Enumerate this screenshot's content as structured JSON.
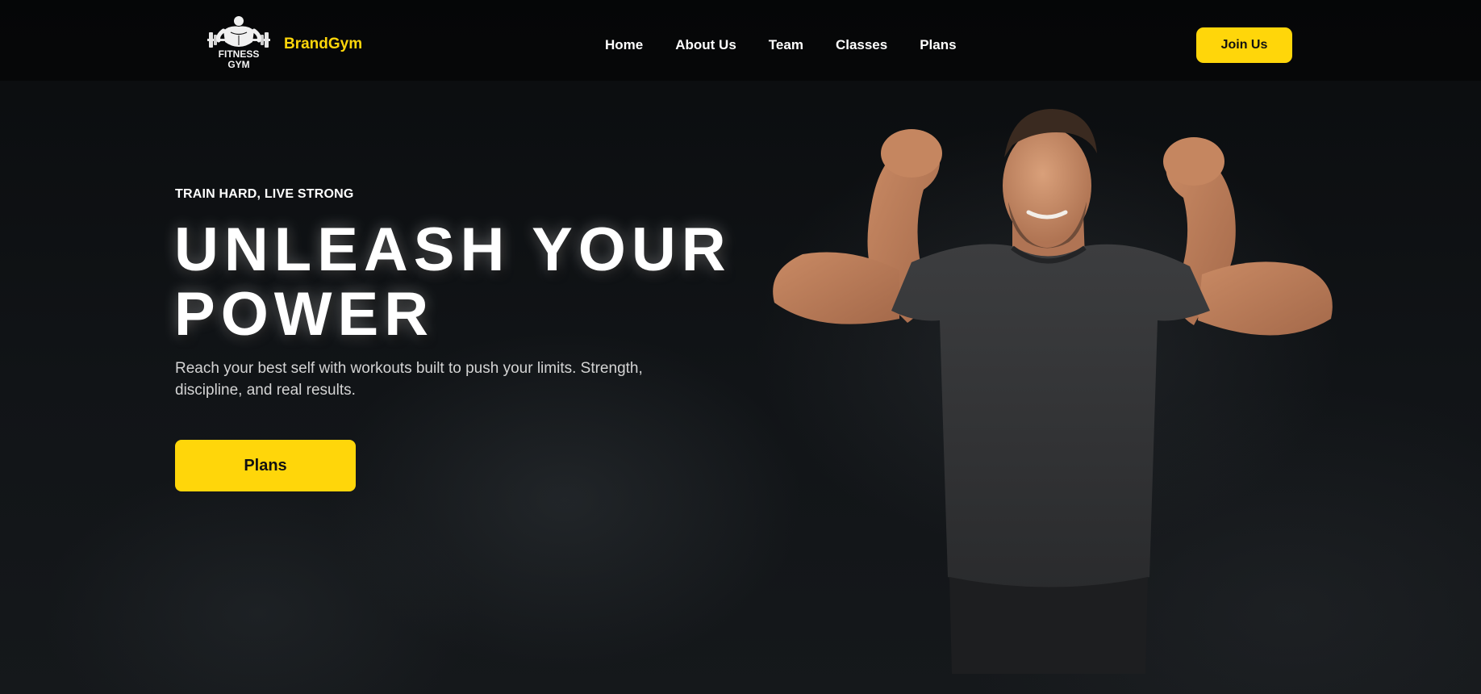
{
  "header": {
    "logo": {
      "icon": "bodybuilder-barbell-logo-icon",
      "line1": "FITNESS",
      "line2": "GYM"
    },
    "brand": "BrandGym",
    "nav": [
      {
        "label": "Home"
      },
      {
        "label": "About Us"
      },
      {
        "label": "Team"
      },
      {
        "label": "Classes"
      },
      {
        "label": "Plans"
      }
    ],
    "join_label": "Join Us"
  },
  "hero": {
    "eyebrow": "TRAIN HARD, LIVE STRONG",
    "headline_line1": "UNLEASH YOUR",
    "headline_line2": "POWER",
    "subtext": "Reach your best self with workouts built to push your limits. Strength, discipline, and real results.",
    "cta_label": "Plans",
    "image": "muscular-man-flexing-photo"
  },
  "colors": {
    "accent": "#ffd60a",
    "background": "#0b0d0f",
    "text": "#ffffff",
    "muted_text": "#d4d4d4"
  }
}
